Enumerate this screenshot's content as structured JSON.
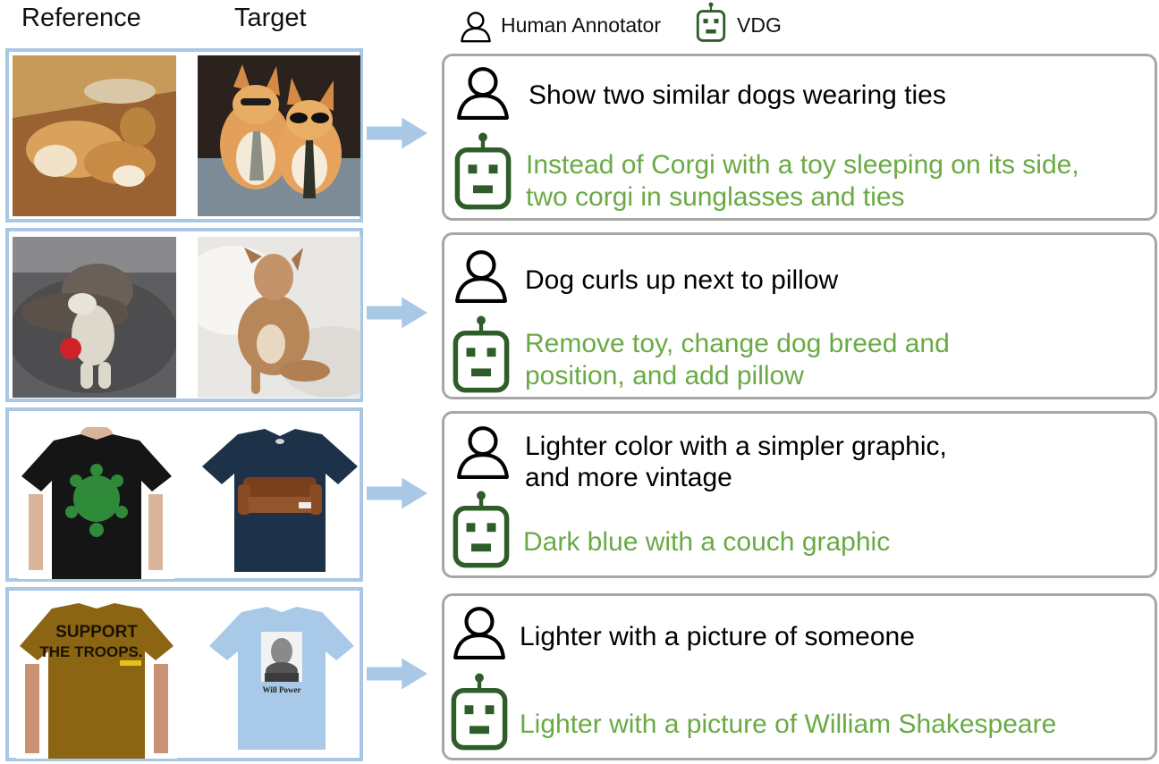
{
  "header": {
    "reference_label": "Reference",
    "target_label": "Target"
  },
  "legend": {
    "human_label": "Human Annotator",
    "vdg_label": "VDG",
    "human_icon": "person-outline-icon",
    "vdg_icon": "robot-icon"
  },
  "colors": {
    "frame_border": "#a9c8e6",
    "arrow": "#a9c8e6",
    "card_border": "#a7a7a7",
    "vdg_text": "#6aaa45",
    "robot_icon": "#2f5d2a"
  },
  "rows": [
    {
      "human_lines": [
        "Show two similar dogs wearing ties"
      ],
      "vdg_lines": [
        "Instead of Corgi with a toy sleeping on its side,",
        "two corgi in sunglasses and ties"
      ]
    },
    {
      "human_lines": [
        "Dog curls up next to pillow"
      ],
      "vdg_lines": [
        "Remove toy, change dog breed and",
        "position, and add pillow"
      ]
    },
    {
      "human_lines": [
        "Lighter color with a simpler graphic,",
        "and more vintage"
      ],
      "vdg_lines": [
        "Dark blue with a couch graphic"
      ]
    },
    {
      "human_lines": [
        "Lighter with a picture of someone"
      ],
      "vdg_lines": [
        "Lighter with a picture of William Shakespeare"
      ]
    }
  ],
  "shirt_text": {
    "support_line1": "SUPPORT",
    "support_line2": "THE TROOPS.",
    "will_power": "Will Power"
  }
}
